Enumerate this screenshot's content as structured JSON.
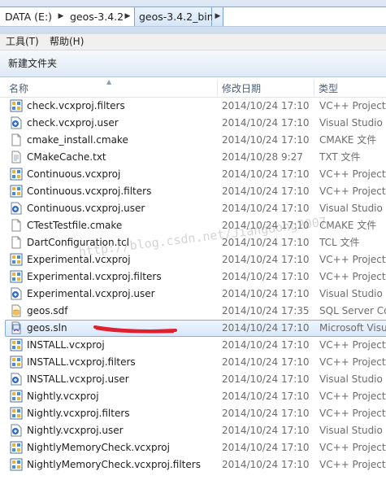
{
  "address": {
    "crumbs": [
      "DATA (E:)",
      "geos-3.4.2",
      "geos-3.4.2_bin"
    ]
  },
  "menu": {
    "items": [
      "工具(T)",
      "帮助(H)"
    ]
  },
  "toolbar": {
    "new_folder": "新建文件夹"
  },
  "columns": {
    "name": "名称",
    "date": "修改日期",
    "type": "类型"
  },
  "watermark": "http://blog.csdn.net/Jiangdong2007",
  "colors": {
    "selection_border": "#84acdd",
    "scribble": "#e0202e"
  },
  "files": [
    {
      "name": "check.vcxproj.filters",
      "date": "2014/10/24 17:10",
      "type": "VC++ Project",
      "icon": "vcxproj-icon"
    },
    {
      "name": "check.vcxproj.user",
      "date": "2014/10/24 17:10",
      "type": "Visual Studio P",
      "icon": "vs-user-icon"
    },
    {
      "name": "cmake_install.cmake",
      "date": "2014/10/24 17:10",
      "type": "CMAKE 文件",
      "icon": "blank-file-icon"
    },
    {
      "name": "CMakeCache.txt",
      "date": "2014/10/28 9:27",
      "type": "TXT 文件",
      "icon": "text-file-icon"
    },
    {
      "name": "Continuous.vcxproj",
      "date": "2014/10/24 17:10",
      "type": "VC++ Project",
      "icon": "vcxproj-icon"
    },
    {
      "name": "Continuous.vcxproj.filters",
      "date": "2014/10/24 17:10",
      "type": "VC++ Project",
      "icon": "vcxproj-icon"
    },
    {
      "name": "Continuous.vcxproj.user",
      "date": "2014/10/24 17:10",
      "type": "Visual Studio P",
      "icon": "vs-user-icon"
    },
    {
      "name": "CTestTestfile.cmake",
      "date": "2014/10/24 17:10",
      "type": "CMAKE 文件",
      "icon": "blank-file-icon"
    },
    {
      "name": "DartConfiguration.tcl",
      "date": "2014/10/24 17:10",
      "type": "TCL 文件",
      "icon": "blank-file-icon"
    },
    {
      "name": "Experimental.vcxproj",
      "date": "2014/10/24 17:10",
      "type": "VC++ Project",
      "icon": "vcxproj-icon"
    },
    {
      "name": "Experimental.vcxproj.filters",
      "date": "2014/10/24 17:10",
      "type": "VC++ Project",
      "icon": "vcxproj-icon"
    },
    {
      "name": "Experimental.vcxproj.user",
      "date": "2014/10/24 17:10",
      "type": "Visual Studio P",
      "icon": "vs-user-icon"
    },
    {
      "name": "geos.sdf",
      "date": "2014/10/24 17:35",
      "type": "SQL Server Co",
      "icon": "sdf-file-icon"
    },
    {
      "name": "geos.sln",
      "date": "2014/10/24 17:10",
      "type": "Microsoft Visu",
      "icon": "sln-file-icon",
      "selected": true
    },
    {
      "name": "INSTALL.vcxproj",
      "date": "2014/10/24 17:10",
      "type": "VC++ Project",
      "icon": "vcxproj-icon"
    },
    {
      "name": "INSTALL.vcxproj.filters",
      "date": "2014/10/24 17:10",
      "type": "VC++ Project",
      "icon": "vcxproj-icon"
    },
    {
      "name": "INSTALL.vcxproj.user",
      "date": "2014/10/24 17:10",
      "type": "Visual Studio P",
      "icon": "vs-user-icon"
    },
    {
      "name": "Nightly.vcxproj",
      "date": "2014/10/24 17:10",
      "type": "VC++ Project",
      "icon": "vcxproj-icon"
    },
    {
      "name": "Nightly.vcxproj.filters",
      "date": "2014/10/24 17:10",
      "type": "VC++ Project",
      "icon": "vcxproj-icon"
    },
    {
      "name": "Nightly.vcxproj.user",
      "date": "2014/10/24 17:10",
      "type": "Visual Studio P",
      "icon": "vs-user-icon"
    },
    {
      "name": "NightlyMemoryCheck.vcxproj",
      "date": "2014/10/24 17:10",
      "type": "VC++ Project",
      "icon": "vcxproj-icon"
    },
    {
      "name": "NightlyMemoryCheck.vcxproj.filters",
      "date": "2014/10/24 17:10",
      "type": "VC++ Project",
      "icon": "vcxproj-icon"
    }
  ]
}
